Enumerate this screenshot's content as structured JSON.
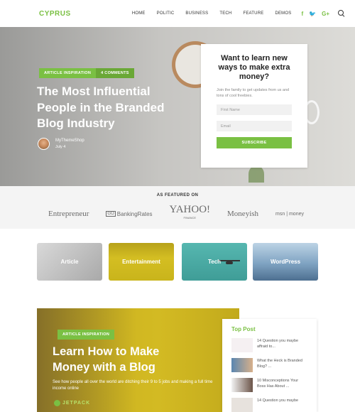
{
  "header": {
    "logo": "CYPRUS",
    "nav": [
      "HOME",
      "POLITIC",
      "BUSINESS",
      "TECH",
      "FEATURE",
      "DEMOS"
    ],
    "social": {
      "facebook": "f",
      "twitter": "🐦",
      "google": "G+"
    }
  },
  "hero": {
    "badges": [
      "ARTICLE INSPIRATION",
      "4 COMMENTS"
    ],
    "title": "The Most Influential People in the Branded Blog Industry",
    "author": "MyThemeShop",
    "date": "July 4"
  },
  "subscribe": {
    "title": "Want to learn new ways to make extra money?",
    "text": "Join the family to get updates from us and tons of cool freebies.",
    "first_name_placeholder": "First Name",
    "email_placeholder": "Email",
    "button": "SUBSCRIBE"
  },
  "featured": {
    "title": "AS FEATURED ON",
    "logos": [
      "Entrepreneur",
      "GO",
      "BankingRates",
      "YAHOO!",
      "FINANCE",
      "Moneyish",
      "msn",
      "money"
    ]
  },
  "categories": [
    "Article",
    "Entertainment",
    "Tech",
    "WordPress"
  ],
  "blog": {
    "badge": "ARTICLE INSPIRATION",
    "title": "Learn How to Make Money with a Blog",
    "text": "See how people all over the world are ditching their 9 to 5 jobs and making a full time income online",
    "brand": "JETPACK"
  },
  "top_post": {
    "title": "Top Post",
    "posts": [
      "14 Question you maybe affraid to...",
      "What the Heck is Branded Blog? ...",
      "10 Misconceptions Your Boss Has About ...",
      "14 Question you maybe"
    ]
  },
  "colors": {
    "accent": "#7ac043"
  }
}
